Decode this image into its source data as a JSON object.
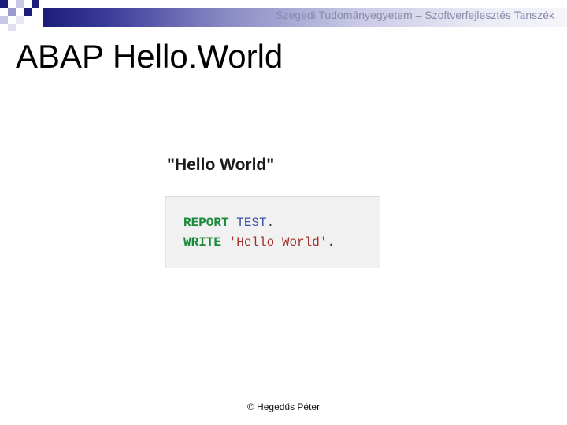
{
  "header": {
    "institution": "Szegedi Tudományegyetem – Szoftverfejlesztés Tanszék",
    "band_color_dark": "#1c1c7a",
    "band_color_light": "#f5f5fa"
  },
  "slide": {
    "title": "ABAP Hello.World",
    "section_heading": "\"Hello World\""
  },
  "code": {
    "line1": {
      "keyword": "REPORT",
      "identifier": "TEST",
      "terminator": "."
    },
    "line2": {
      "keyword": "WRITE",
      "string": "'Hello World'",
      "terminator": "."
    },
    "colors": {
      "keyword": "#1a8a3a",
      "identifier": "#3c4fa8",
      "string": "#a3302a",
      "background": "#f1f1f1"
    }
  },
  "footer": {
    "author": "© Hegedűs Péter"
  }
}
